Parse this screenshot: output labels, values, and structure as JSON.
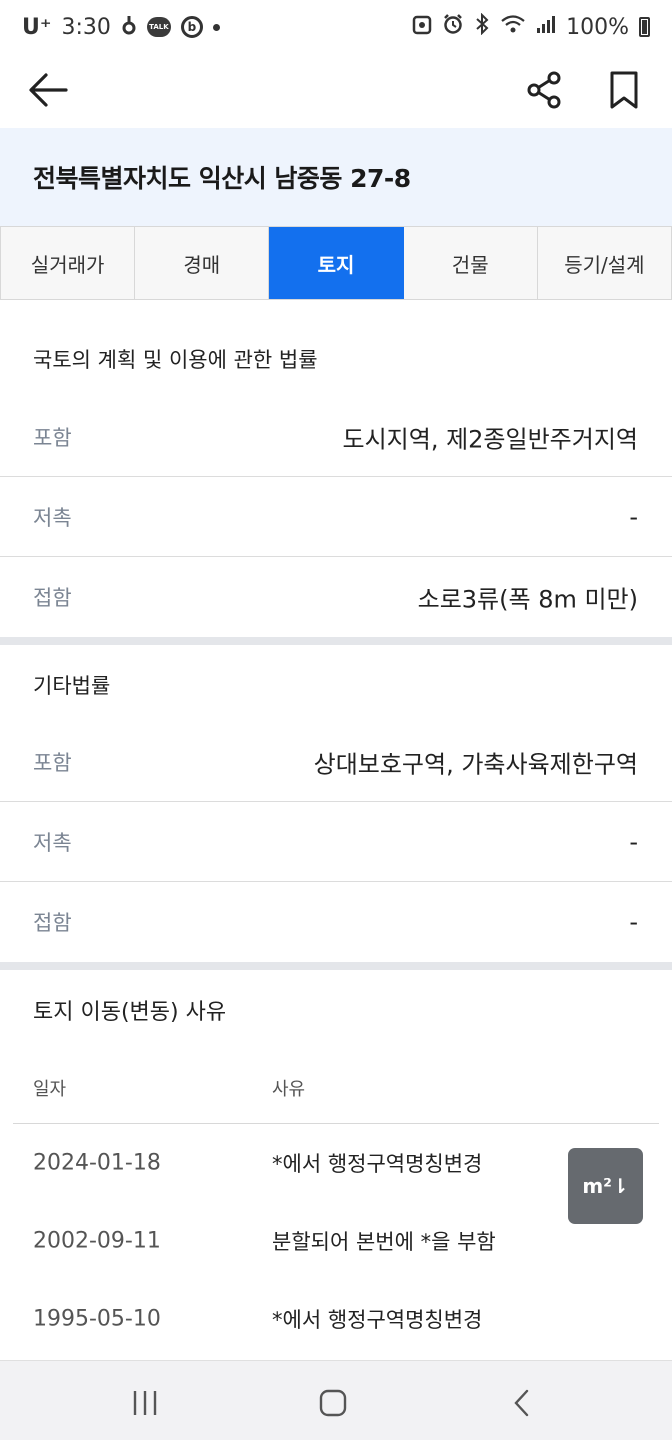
{
  "status_bar": {
    "carrier": "U⁺",
    "time": "3:30",
    "talk_badge": "TALK",
    "b_badge": "b",
    "battery": "100%"
  },
  "address": "전북특별자치도 익산시 남중동 27-8",
  "tabs": [
    {
      "label": "실거래가",
      "active": false
    },
    {
      "label": "경매",
      "active": false
    },
    {
      "label": "토지",
      "active": true
    },
    {
      "label": "건물",
      "active": false
    },
    {
      "label": "등기/설계",
      "active": false
    }
  ],
  "section1": {
    "title": "국토의 계획 및 이용에 관한 법률",
    "rows": [
      {
        "label": "포함",
        "value": "도시지역, 제2종일반주거지역"
      },
      {
        "label": "저촉",
        "value": "-"
      },
      {
        "label": "접함",
        "value": "소로3류(폭 8m 미만)"
      }
    ]
  },
  "section2": {
    "title": "기타법률",
    "rows": [
      {
        "label": "포함",
        "value": "상대보호구역, 가축사육제한구역"
      },
      {
        "label": "저촉",
        "value": "-"
      },
      {
        "label": "접함",
        "value": "-"
      }
    ]
  },
  "section3": {
    "title": "토지 이동(변동) 사유",
    "columns": [
      "일자",
      "사유"
    ],
    "rows": [
      {
        "date": "2024-01-18",
        "reason": "*에서 행정구역명칭변경"
      },
      {
        "date": "2002-09-11",
        "reason": "분할되어 본번에 *을 부함"
      },
      {
        "date": "1995-05-10",
        "reason": "*에서 행정구역명칭변경"
      }
    ]
  },
  "unit_toggle": "m²⇂",
  "icons": {
    "back": "arrow-left-icon",
    "share": "share-icon",
    "bookmark": "bookmark-icon",
    "nav_recents": "recents-icon",
    "nav_home": "home-icon",
    "nav_back": "nav-back-icon"
  },
  "colors": {
    "accent": "#1370ee",
    "address_band": "#eef4fd",
    "label_gray": "#7b8593",
    "unit_button": "#666a6f"
  }
}
